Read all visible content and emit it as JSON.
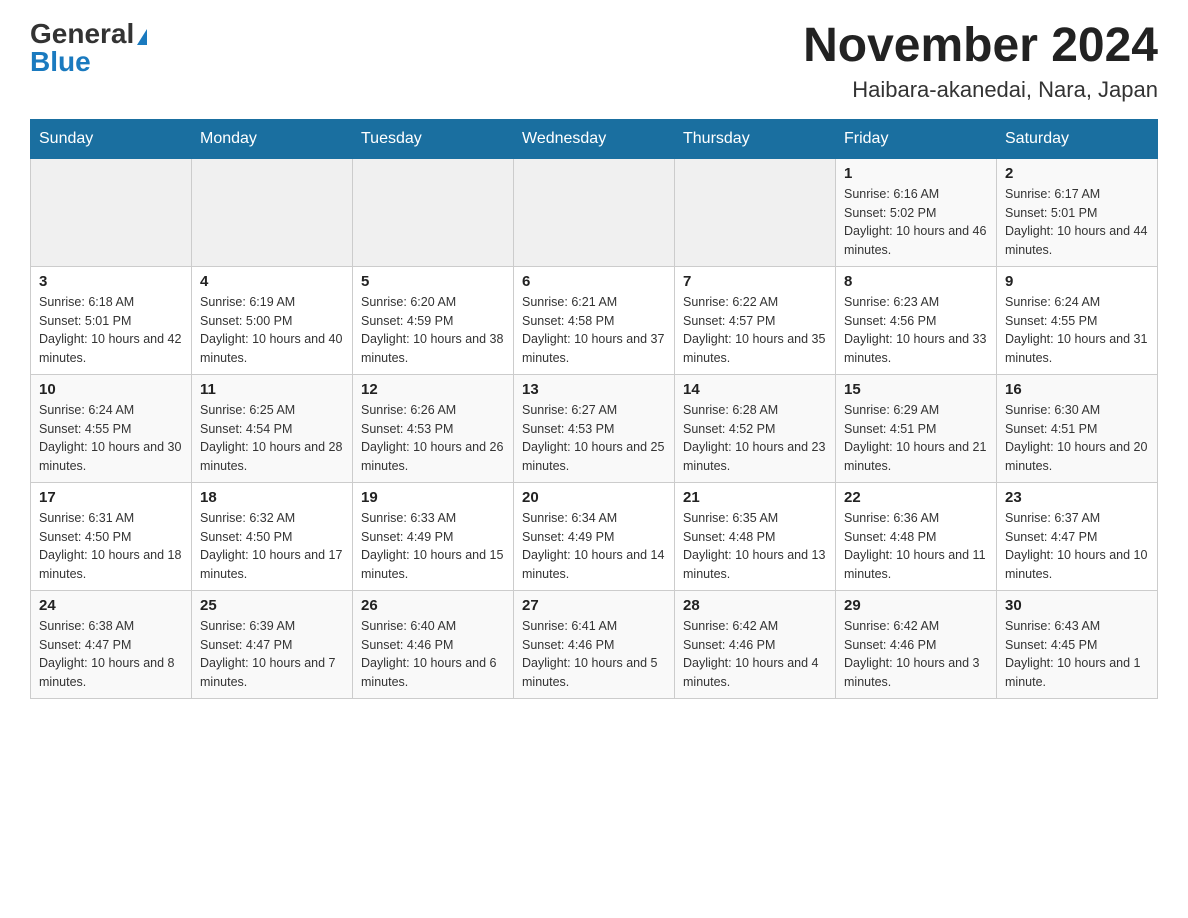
{
  "header": {
    "logo_general": "General",
    "logo_blue": "Blue",
    "month_title": "November 2024",
    "location": "Haibara-akanedai, Nara, Japan"
  },
  "weekdays": [
    "Sunday",
    "Monday",
    "Tuesday",
    "Wednesday",
    "Thursday",
    "Friday",
    "Saturday"
  ],
  "weeks": [
    [
      {
        "day": "",
        "sunrise": "",
        "sunset": "",
        "daylight": "",
        "empty": true
      },
      {
        "day": "",
        "sunrise": "",
        "sunset": "",
        "daylight": "",
        "empty": true
      },
      {
        "day": "",
        "sunrise": "",
        "sunset": "",
        "daylight": "",
        "empty": true
      },
      {
        "day": "",
        "sunrise": "",
        "sunset": "",
        "daylight": "",
        "empty": true
      },
      {
        "day": "",
        "sunrise": "",
        "sunset": "",
        "daylight": "",
        "empty": true
      },
      {
        "day": "1",
        "sunrise": "Sunrise: 6:16 AM",
        "sunset": "Sunset: 5:02 PM",
        "daylight": "Daylight: 10 hours and 46 minutes.",
        "empty": false
      },
      {
        "day": "2",
        "sunrise": "Sunrise: 6:17 AM",
        "sunset": "Sunset: 5:01 PM",
        "daylight": "Daylight: 10 hours and 44 minutes.",
        "empty": false
      }
    ],
    [
      {
        "day": "3",
        "sunrise": "Sunrise: 6:18 AM",
        "sunset": "Sunset: 5:01 PM",
        "daylight": "Daylight: 10 hours and 42 minutes.",
        "empty": false
      },
      {
        "day": "4",
        "sunrise": "Sunrise: 6:19 AM",
        "sunset": "Sunset: 5:00 PM",
        "daylight": "Daylight: 10 hours and 40 minutes.",
        "empty": false
      },
      {
        "day": "5",
        "sunrise": "Sunrise: 6:20 AM",
        "sunset": "Sunset: 4:59 PM",
        "daylight": "Daylight: 10 hours and 38 minutes.",
        "empty": false
      },
      {
        "day": "6",
        "sunrise": "Sunrise: 6:21 AM",
        "sunset": "Sunset: 4:58 PM",
        "daylight": "Daylight: 10 hours and 37 minutes.",
        "empty": false
      },
      {
        "day": "7",
        "sunrise": "Sunrise: 6:22 AM",
        "sunset": "Sunset: 4:57 PM",
        "daylight": "Daylight: 10 hours and 35 minutes.",
        "empty": false
      },
      {
        "day": "8",
        "sunrise": "Sunrise: 6:23 AM",
        "sunset": "Sunset: 4:56 PM",
        "daylight": "Daylight: 10 hours and 33 minutes.",
        "empty": false
      },
      {
        "day": "9",
        "sunrise": "Sunrise: 6:24 AM",
        "sunset": "Sunset: 4:55 PM",
        "daylight": "Daylight: 10 hours and 31 minutes.",
        "empty": false
      }
    ],
    [
      {
        "day": "10",
        "sunrise": "Sunrise: 6:24 AM",
        "sunset": "Sunset: 4:55 PM",
        "daylight": "Daylight: 10 hours and 30 minutes.",
        "empty": false
      },
      {
        "day": "11",
        "sunrise": "Sunrise: 6:25 AM",
        "sunset": "Sunset: 4:54 PM",
        "daylight": "Daylight: 10 hours and 28 minutes.",
        "empty": false
      },
      {
        "day": "12",
        "sunrise": "Sunrise: 6:26 AM",
        "sunset": "Sunset: 4:53 PM",
        "daylight": "Daylight: 10 hours and 26 minutes.",
        "empty": false
      },
      {
        "day": "13",
        "sunrise": "Sunrise: 6:27 AM",
        "sunset": "Sunset: 4:53 PM",
        "daylight": "Daylight: 10 hours and 25 minutes.",
        "empty": false
      },
      {
        "day": "14",
        "sunrise": "Sunrise: 6:28 AM",
        "sunset": "Sunset: 4:52 PM",
        "daylight": "Daylight: 10 hours and 23 minutes.",
        "empty": false
      },
      {
        "day": "15",
        "sunrise": "Sunrise: 6:29 AM",
        "sunset": "Sunset: 4:51 PM",
        "daylight": "Daylight: 10 hours and 21 minutes.",
        "empty": false
      },
      {
        "day": "16",
        "sunrise": "Sunrise: 6:30 AM",
        "sunset": "Sunset: 4:51 PM",
        "daylight": "Daylight: 10 hours and 20 minutes.",
        "empty": false
      }
    ],
    [
      {
        "day": "17",
        "sunrise": "Sunrise: 6:31 AM",
        "sunset": "Sunset: 4:50 PM",
        "daylight": "Daylight: 10 hours and 18 minutes.",
        "empty": false
      },
      {
        "day": "18",
        "sunrise": "Sunrise: 6:32 AM",
        "sunset": "Sunset: 4:50 PM",
        "daylight": "Daylight: 10 hours and 17 minutes.",
        "empty": false
      },
      {
        "day": "19",
        "sunrise": "Sunrise: 6:33 AM",
        "sunset": "Sunset: 4:49 PM",
        "daylight": "Daylight: 10 hours and 15 minutes.",
        "empty": false
      },
      {
        "day": "20",
        "sunrise": "Sunrise: 6:34 AM",
        "sunset": "Sunset: 4:49 PM",
        "daylight": "Daylight: 10 hours and 14 minutes.",
        "empty": false
      },
      {
        "day": "21",
        "sunrise": "Sunrise: 6:35 AM",
        "sunset": "Sunset: 4:48 PM",
        "daylight": "Daylight: 10 hours and 13 minutes.",
        "empty": false
      },
      {
        "day": "22",
        "sunrise": "Sunrise: 6:36 AM",
        "sunset": "Sunset: 4:48 PM",
        "daylight": "Daylight: 10 hours and 11 minutes.",
        "empty": false
      },
      {
        "day": "23",
        "sunrise": "Sunrise: 6:37 AM",
        "sunset": "Sunset: 4:47 PM",
        "daylight": "Daylight: 10 hours and 10 minutes.",
        "empty": false
      }
    ],
    [
      {
        "day": "24",
        "sunrise": "Sunrise: 6:38 AM",
        "sunset": "Sunset: 4:47 PM",
        "daylight": "Daylight: 10 hours and 8 minutes.",
        "empty": false
      },
      {
        "day": "25",
        "sunrise": "Sunrise: 6:39 AM",
        "sunset": "Sunset: 4:47 PM",
        "daylight": "Daylight: 10 hours and 7 minutes.",
        "empty": false
      },
      {
        "day": "26",
        "sunrise": "Sunrise: 6:40 AM",
        "sunset": "Sunset: 4:46 PM",
        "daylight": "Daylight: 10 hours and 6 minutes.",
        "empty": false
      },
      {
        "day": "27",
        "sunrise": "Sunrise: 6:41 AM",
        "sunset": "Sunset: 4:46 PM",
        "daylight": "Daylight: 10 hours and 5 minutes.",
        "empty": false
      },
      {
        "day": "28",
        "sunrise": "Sunrise: 6:42 AM",
        "sunset": "Sunset: 4:46 PM",
        "daylight": "Daylight: 10 hours and 4 minutes.",
        "empty": false
      },
      {
        "day": "29",
        "sunrise": "Sunrise: 6:42 AM",
        "sunset": "Sunset: 4:46 PM",
        "daylight": "Daylight: 10 hours and 3 minutes.",
        "empty": false
      },
      {
        "day": "30",
        "sunrise": "Sunrise: 6:43 AM",
        "sunset": "Sunset: 4:45 PM",
        "daylight": "Daylight: 10 hours and 1 minute.",
        "empty": false
      }
    ]
  ]
}
